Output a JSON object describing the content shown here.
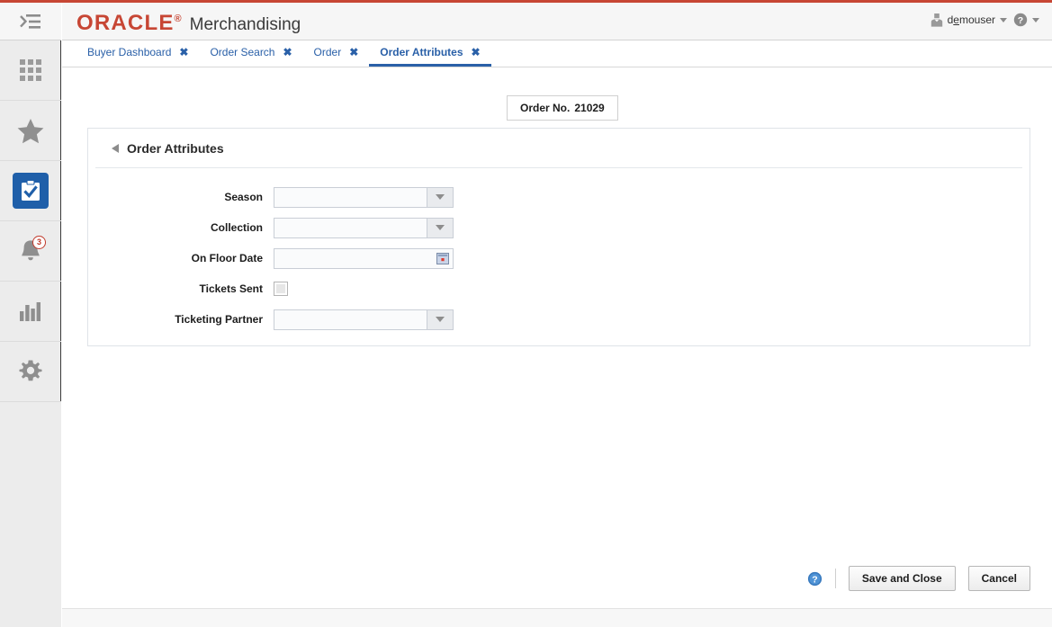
{
  "theme": {
    "brand_red": "#c74634",
    "link_blue": "#2a60a8",
    "selected_tile": "#1f5fa9",
    "badge_red": "#c0392b"
  },
  "header": {
    "logo_text": "ORACLE",
    "logo_tm": "®",
    "app_name": "Merchandising",
    "user_name_pre": "d",
    "user_name_accesskey": "e",
    "user_name_post": "mouser",
    "user_icon": "user-avatar-icon",
    "help_icon": "help-circle-icon",
    "menu_icon": "collapse-menu-icon"
  },
  "rail": {
    "items": [
      {
        "icon": "collapse-menu-icon",
        "name": "collapse-menu",
        "selected": false
      },
      {
        "icon": "grid-apps-icon",
        "name": "applications",
        "selected": false
      },
      {
        "icon": "star-icon",
        "name": "favorites",
        "selected": false
      },
      {
        "icon": "clipboard-check-icon",
        "name": "tasks",
        "selected": true
      },
      {
        "icon": "bell-icon",
        "name": "notifications",
        "selected": false,
        "badge": "3"
      },
      {
        "icon": "bar-chart-icon",
        "name": "reports",
        "selected": false
      },
      {
        "icon": "gear-icon",
        "name": "settings",
        "selected": false
      }
    ]
  },
  "tabs": [
    {
      "label": "Buyer Dashboard",
      "active": false,
      "close_glyph": "✖"
    },
    {
      "label": "Order Search",
      "active": false,
      "close_glyph": "✖"
    },
    {
      "label": "Order",
      "active": false,
      "close_glyph": "✖"
    },
    {
      "label": "Order Attributes",
      "active": true,
      "close_glyph": "✖"
    }
  ],
  "content": {
    "order_no_label": "Order No.",
    "order_no_value": "21029",
    "panel_title": "Order Attributes",
    "fields": [
      {
        "label": "Season",
        "type": "combo",
        "value": "",
        "name": "season"
      },
      {
        "label": "Collection",
        "type": "combo",
        "value": "",
        "name": "collection"
      },
      {
        "label": "On Floor Date",
        "type": "date",
        "value": "",
        "name": "on-floor-date"
      },
      {
        "label": "Tickets Sent",
        "type": "checkbox",
        "checked": false,
        "name": "tickets-sent"
      },
      {
        "label": "Ticketing Partner",
        "type": "combo",
        "value": "",
        "name": "ticketing-partner"
      }
    ]
  },
  "footer": {
    "help_icon": "help-circle-icon",
    "save_label": "Save and Close",
    "cancel_label": "Cancel"
  }
}
